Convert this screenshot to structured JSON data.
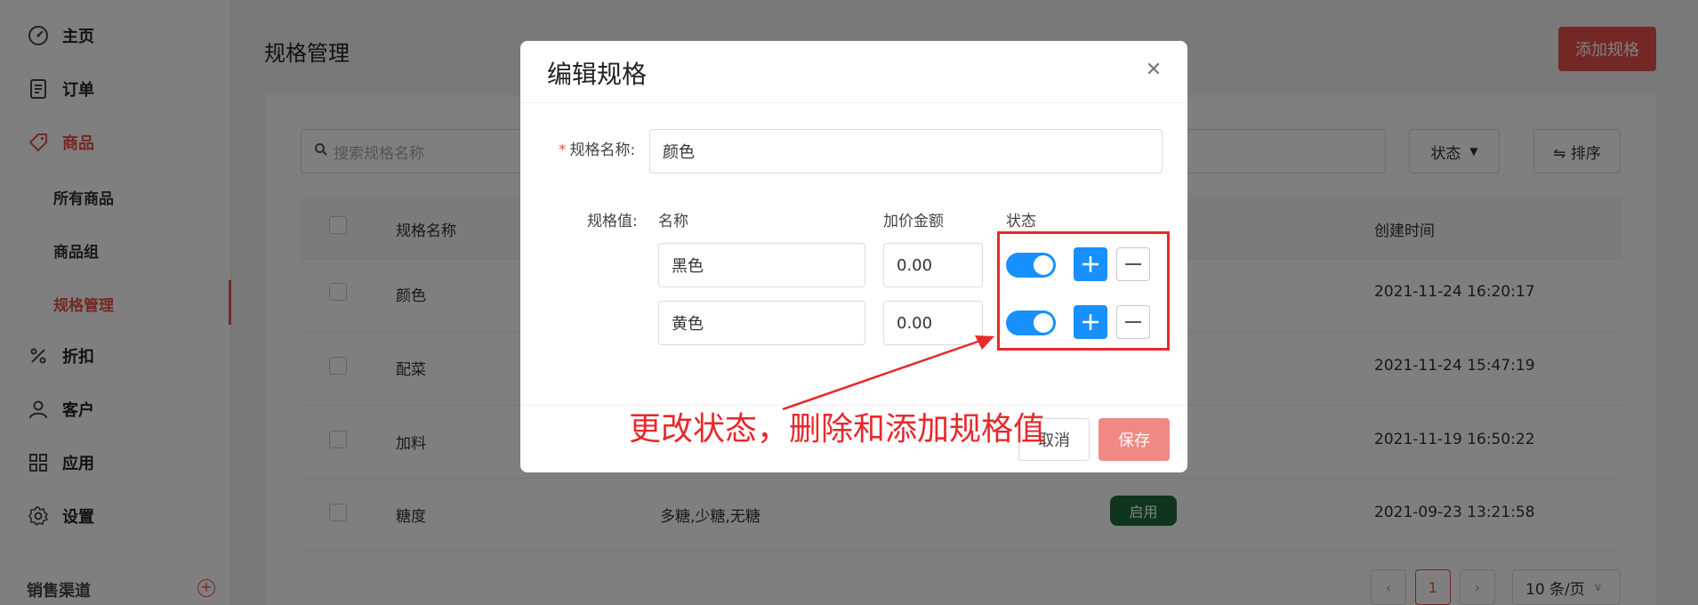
{
  "sidebar": {
    "items": [
      {
        "label": "主页",
        "icon": "dashboard-icon"
      },
      {
        "label": "订单",
        "icon": "order-icon"
      },
      {
        "label": "商品",
        "icon": "tag-icon"
      },
      {
        "label": "折扣",
        "icon": "percent-icon"
      },
      {
        "label": "客户",
        "icon": "user-icon"
      },
      {
        "label": "应用",
        "icon": "grid-icon"
      },
      {
        "label": "设置",
        "icon": "gear-icon"
      }
    ],
    "sub_items": [
      "所有商品",
      "商品组",
      "规格管理"
    ],
    "section_label": "销售渠道"
  },
  "page": {
    "title": "规格管理",
    "add_button": "添加规格",
    "search_placeholder": "搜索规格名称",
    "status_filter": "状态",
    "sort_button": "⇋ 排序"
  },
  "table": {
    "headers": [
      "规格名称",
      "创建时间"
    ],
    "rows": [
      {
        "name": "颜色",
        "values": "",
        "status": "",
        "created": "2021-11-24 16:20:17"
      },
      {
        "name": "配菜",
        "values": "",
        "status": "",
        "created": "2021-11-24 15:47:19"
      },
      {
        "name": "加料",
        "values": "",
        "status": "",
        "created": "2021-11-19 16:50:22"
      },
      {
        "name": "糖度",
        "values": "多糖,少糖,无糖",
        "status": "启用",
        "created": "2021-09-23 13:21:58"
      }
    ]
  },
  "pagination": {
    "current": "1",
    "page_size": "10 条/页"
  },
  "modal": {
    "title": "编辑规格",
    "spec_name_label": "规格名称:",
    "spec_name_value": "颜色",
    "spec_values_label": "规格值:",
    "col_name": "名称",
    "col_price": "加价金额",
    "col_status": "状态",
    "values": [
      {
        "name": "黑色",
        "price": "0.00",
        "enabled": true
      },
      {
        "name": "黄色",
        "price": "0.00",
        "enabled": true
      }
    ],
    "cancel": "取消",
    "save": "保存"
  },
  "annotation": "更改状态，删除和添加规格值",
  "colors": {
    "accent": "#e8504a",
    "primary": "#1890ff",
    "annotation": "#e8282b",
    "badge": "#1e6a3a"
  }
}
